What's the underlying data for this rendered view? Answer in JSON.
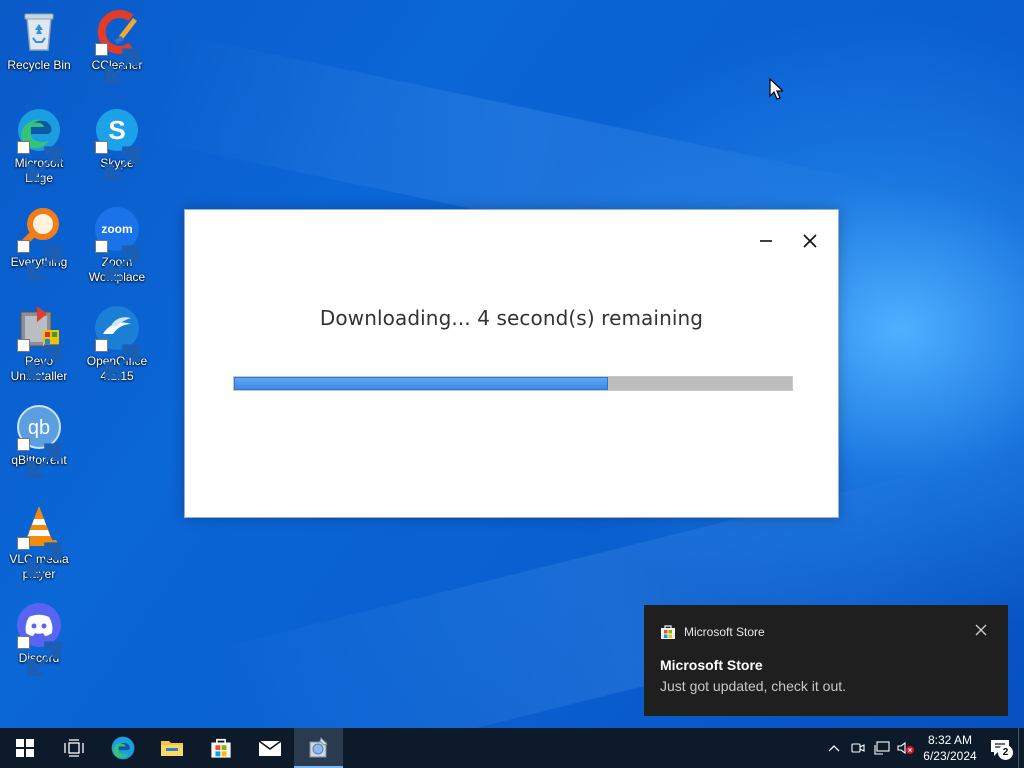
{
  "desktop": {
    "icons": [
      {
        "label": "Recycle Bin"
      },
      {
        "label": "CCleaner"
      },
      {
        "label": "Microsoft Edge"
      },
      {
        "label": "Skype"
      },
      {
        "label": "Everything"
      },
      {
        "label": "Zoom Workplace"
      },
      {
        "label": "Revo Uninstaller"
      },
      {
        "label": "OpenOffice 4.1.15"
      },
      {
        "label": "qBittorrent"
      },
      {
        "label": "VLC media player"
      },
      {
        "label": "Discord"
      }
    ]
  },
  "dialog": {
    "message": "Downloading... 4 second(s) remaining",
    "progress_percent": 67,
    "progress_color": "#3d8be6"
  },
  "toast": {
    "app_name": "Microsoft Store",
    "title": "Microsoft Store",
    "body": "Just got updated, check it out."
  },
  "taskbar": {
    "pinned": [
      "windows-start-icon",
      "task-view-icon",
      "edge-icon",
      "file-explorer-icon",
      "store-icon",
      "mail-icon",
      "installer-icon"
    ],
    "clock": {
      "time": "8:32 AM",
      "date": "6/23/2024"
    },
    "notification_count": "2"
  },
  "colors": {
    "desktop_blue": "#0b66d6",
    "taskbar": "#0d1a2a",
    "toast_bg": "#1f1f1f"
  }
}
